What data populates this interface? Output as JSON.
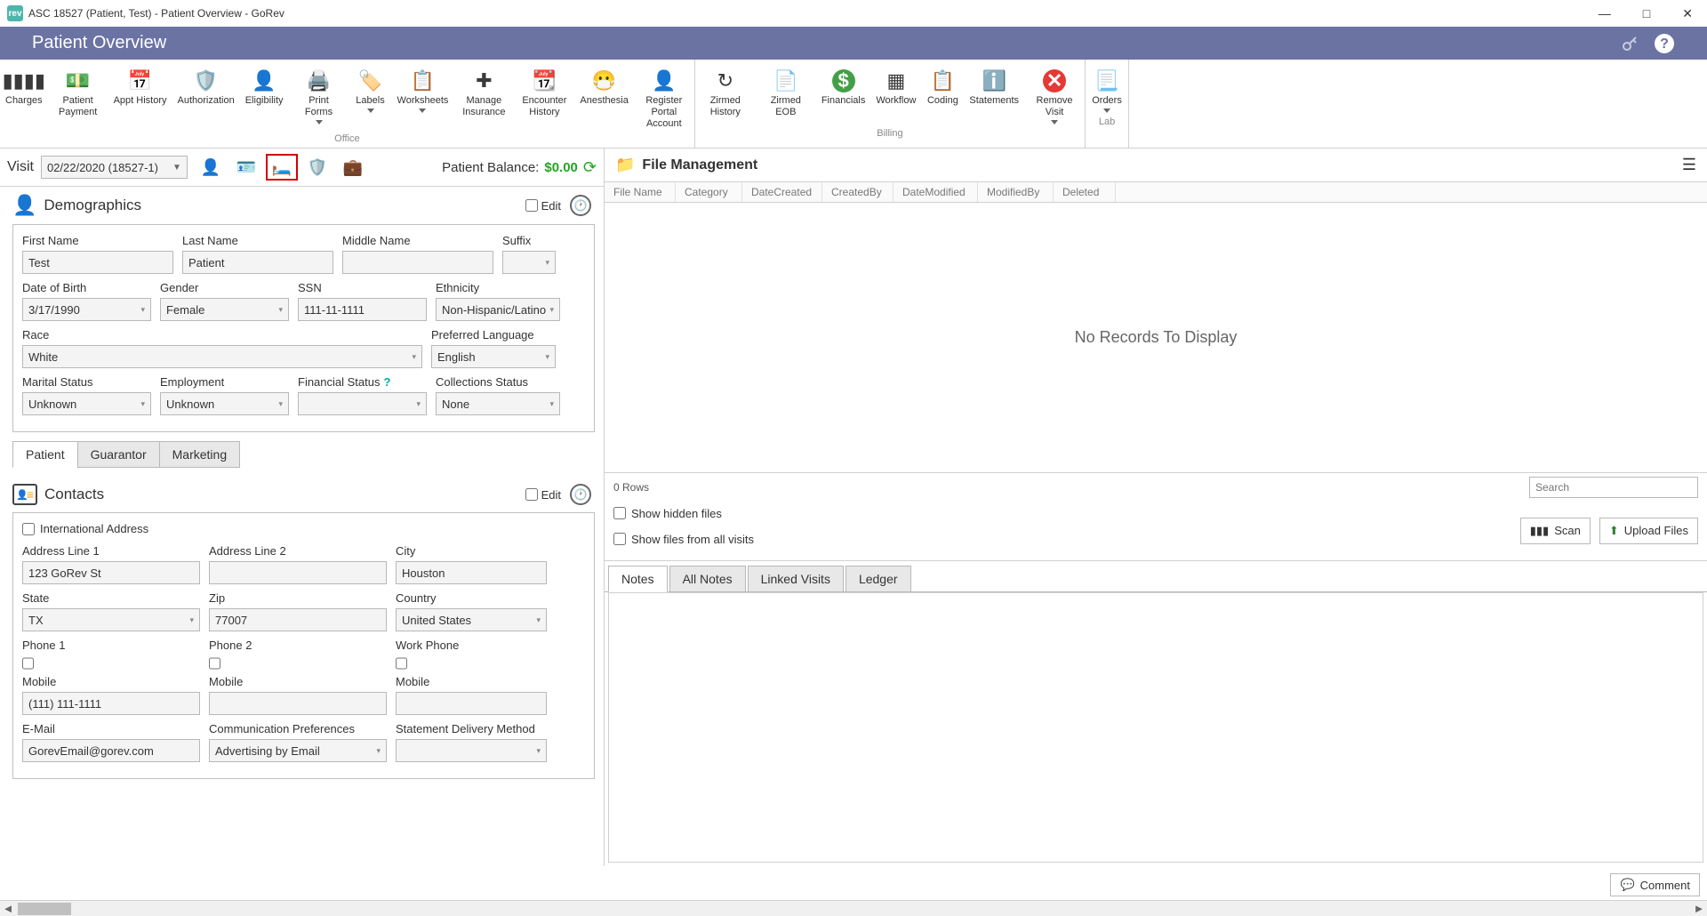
{
  "window": {
    "title": "ASC 18527 (Patient, Test) - Patient Overview - GoRev",
    "app_badge": "rev"
  },
  "header": {
    "title": "Patient Overview"
  },
  "ribbon": {
    "office": {
      "label": "Office",
      "items": [
        {
          "label": "Charges"
        },
        {
          "label": "Patient Payment"
        },
        {
          "label": "Appt History"
        },
        {
          "label": "Authorization"
        },
        {
          "label": "Eligibility"
        },
        {
          "label": "Print Forms"
        },
        {
          "label": "Labels"
        },
        {
          "label": "Worksheets"
        },
        {
          "label": "Manage Insurance"
        },
        {
          "label": "Encounter History"
        },
        {
          "label": "Anesthesia"
        },
        {
          "label": "Register Portal Account"
        }
      ]
    },
    "billing": {
      "label": "Billing",
      "items": [
        {
          "label": "Zirmed History"
        },
        {
          "label": "Zirmed EOB"
        },
        {
          "label": "Financials"
        },
        {
          "label": "Workflow"
        },
        {
          "label": "Coding"
        },
        {
          "label": "Statements"
        },
        {
          "label": "Remove Visit"
        },
        {
          "label": "Orders"
        }
      ]
    },
    "lab": {
      "label": "Lab"
    }
  },
  "visit_bar": {
    "label": "Visit",
    "selected": "02/22/2020 (18527-1)",
    "balance_label": "Patient Balance:",
    "balance_value": "$0.00"
  },
  "demographics": {
    "title": "Demographics",
    "edit": "Edit",
    "fields": {
      "first_name_label": "First Name",
      "first_name": "Test",
      "last_name_label": "Last Name",
      "last_name": "Patient",
      "middle_name_label": "Middle Name",
      "middle_name": "",
      "suffix_label": "Suffix",
      "suffix": "",
      "dob_label": "Date of Birth",
      "dob": "3/17/1990",
      "gender_label": "Gender",
      "gender": "Female",
      "ssn_label": "SSN",
      "ssn": "111-11-1111",
      "ethnicity_label": "Ethnicity",
      "ethnicity": "Non-Hispanic/Latino",
      "race_label": "Race",
      "race": "White",
      "pref_lang_label": "Preferred Language",
      "pref_lang": "English",
      "marital_label": "Marital Status",
      "marital": "Unknown",
      "employment_label": "Employment",
      "employment": "Unknown",
      "fin_status_label": "Financial Status",
      "fin_status": "",
      "collections_label": "Collections Status",
      "collections": "None"
    },
    "tabs": [
      "Patient",
      "Guarantor",
      "Marketing"
    ]
  },
  "contacts": {
    "title": "Contacts",
    "edit": "Edit",
    "intl": "International Address",
    "fields": {
      "addr1_label": "Address Line 1",
      "addr1": "123 GoRev St",
      "addr2_label": "Address Line 2",
      "addr2": "",
      "city_label": "City",
      "city": "Houston",
      "state_label": "State",
      "state": "TX",
      "zip_label": "Zip",
      "zip": "77007",
      "country_label": "Country",
      "country": "United States",
      "phone1_label": "Phone 1",
      "phone1_mobile": "Mobile",
      "phone1": "(111) 111-1111",
      "phone2_label": "Phone 2",
      "phone2_mobile": "Mobile",
      "phone2": "",
      "workphone_label": "Work Phone",
      "workphone_mobile": "Mobile",
      "workphone": "",
      "email_label": "E-Mail",
      "email": "GorevEmail@gorev.com",
      "commpref_label": "Communication Preferences",
      "commpref": "Advertising by Email",
      "stmt_label": "Statement Delivery Method",
      "stmt": ""
    }
  },
  "files": {
    "title": "File Management",
    "cols": [
      "File Name",
      "Category",
      "DateCreated",
      "CreatedBy",
      "DateModified",
      "ModifiedBy",
      "Deleted"
    ],
    "empty": "No Records To Display",
    "rows": "0 Rows",
    "search_placeholder": "Search",
    "show_hidden": "Show hidden files",
    "show_all": "Show files from all visits",
    "scan": "Scan",
    "upload": "Upload Files"
  },
  "notes": {
    "tabs": [
      "Notes",
      "All Notes",
      "Linked Visits",
      "Ledger"
    ]
  },
  "comment": "Comment"
}
